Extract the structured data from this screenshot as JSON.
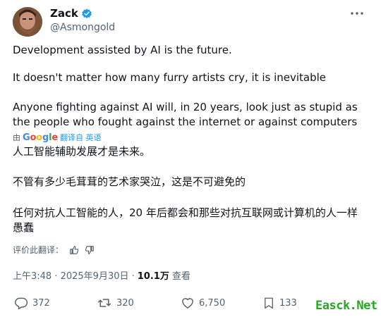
{
  "user": {
    "name": "Zack",
    "handle": "@Asmongold"
  },
  "tweet": {
    "paragraphs": [
      "Development assisted by AI is the future.",
      "It doesn't matter how many furry artists cry, it is inevitable",
      "Anyone fighting against AI will, in 20 years, look just as stupid as the people who fought against the internet or against computers"
    ]
  },
  "translation": {
    "by": "由",
    "provider": "Google",
    "label": "翻译自 英语",
    "paragraphs": [
      "人工智能辅助发展才是未来。",
      "不管有多少毛茸茸的艺术家哭泣，这是不可避免的",
      "任何对抗人工智能的人，20 年后都会和那些对抗互联网或计算机的人一样愚蠢"
    ],
    "rate_label": "评价此翻译："
  },
  "meta": {
    "timestamp": "上午3:48 · 2025年9月30日 ·",
    "views": "10.1万",
    "views_label": "查看"
  },
  "actions": {
    "replies": "372",
    "reposts": "320",
    "likes": "6,750",
    "bookmarks": "133"
  },
  "watermark": "Easck.Net",
  "colors": {
    "accent": "#1d9bf0",
    "text": "#0f1419",
    "muted": "#536471",
    "watermark": "#26a826"
  }
}
